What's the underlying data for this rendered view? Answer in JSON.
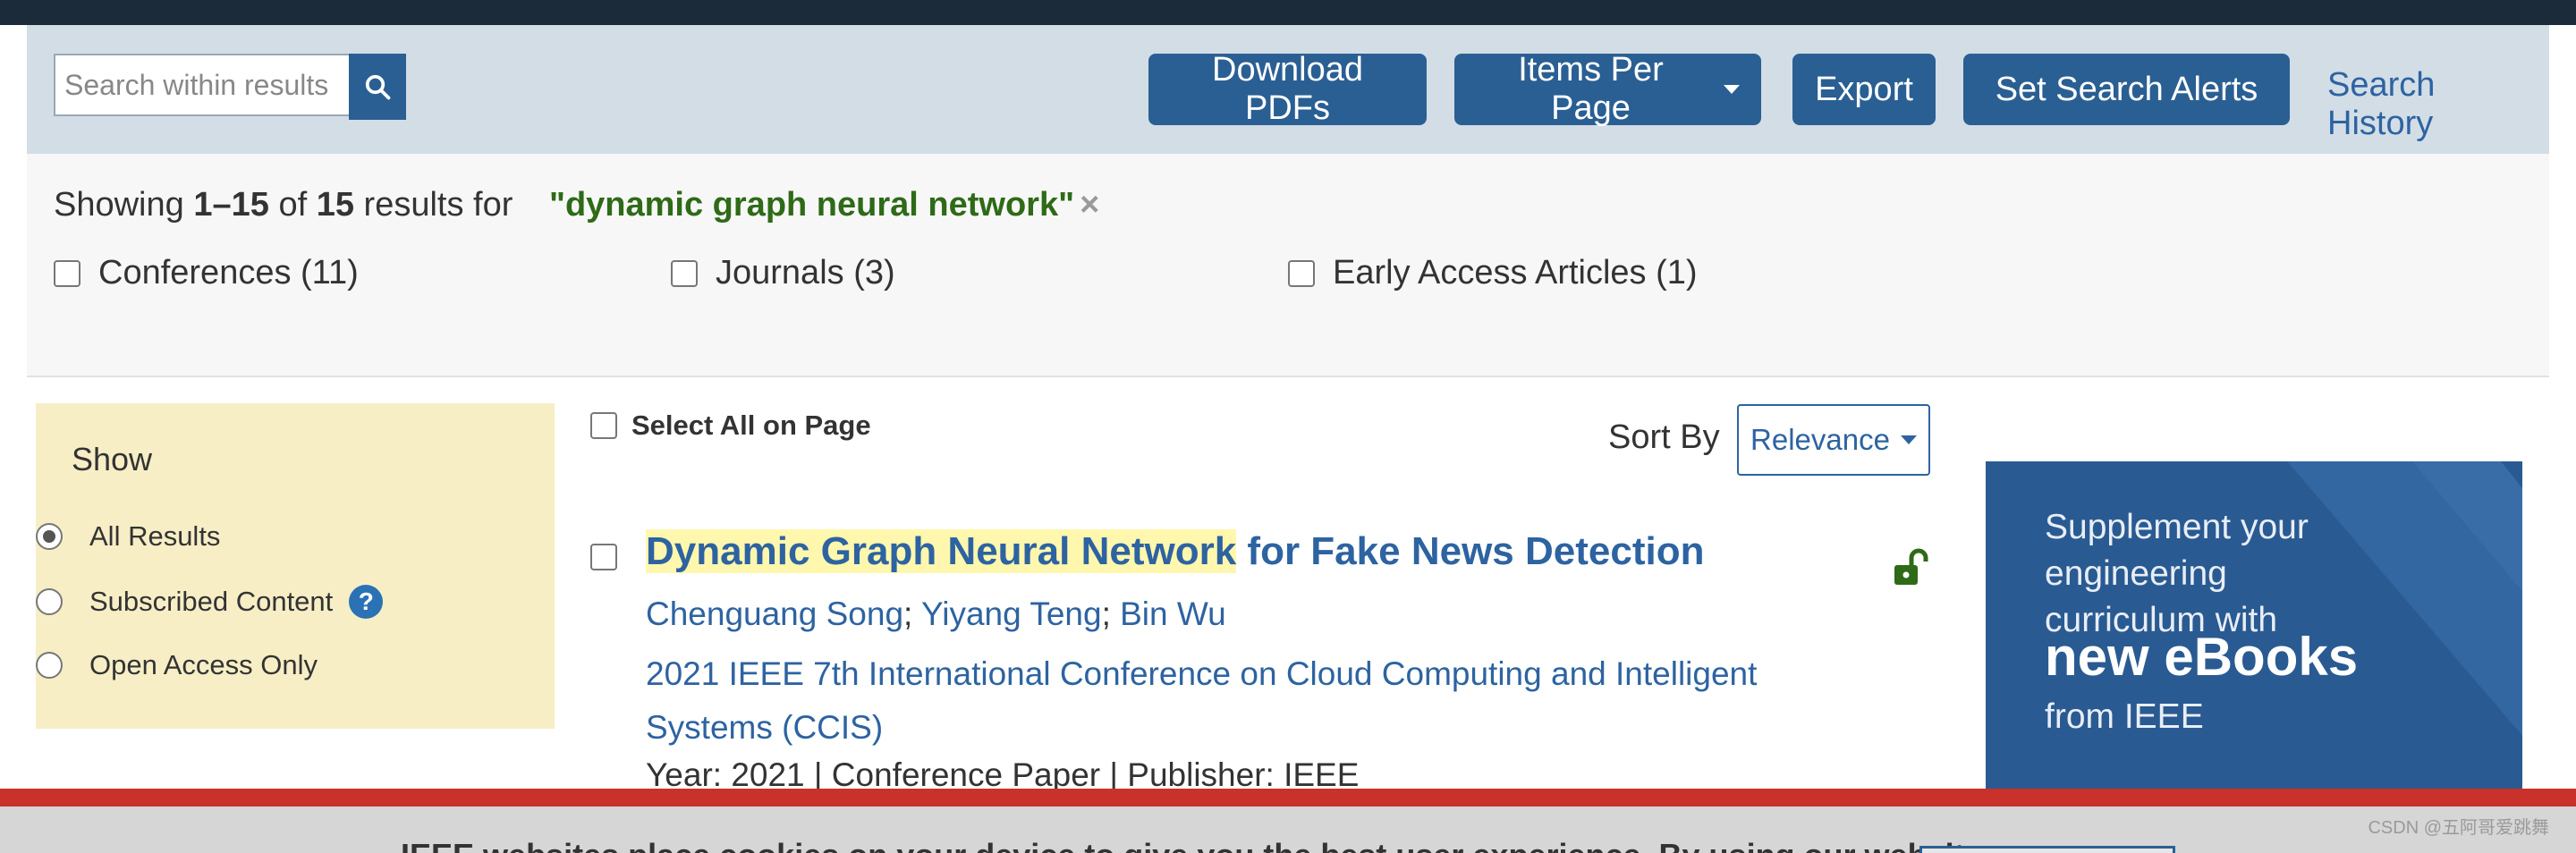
{
  "toolbar": {
    "search_placeholder": "Search within results",
    "download_pdfs": "Download PDFs",
    "items_per_page": "Items Per Page",
    "export": "Export",
    "set_search_alerts": "Set Search Alerts",
    "search_history": "Search History"
  },
  "results_summary": {
    "showing": "Showing",
    "range": "1–15",
    "of": "of",
    "total": "15",
    "results_for": "results for",
    "query": "\"dynamic graph neural network\"",
    "clear_symbol": "×"
  },
  "facets": [
    {
      "label": "Conferences (11)"
    },
    {
      "label": "Journals (3)"
    },
    {
      "label": "Early Access Articles (1)"
    }
  ],
  "filters": {
    "title": "Show",
    "options": [
      {
        "label": "All Results",
        "selected": true
      },
      {
        "label": "Subscribed Content",
        "selected": false
      },
      {
        "label": "Open Access Only",
        "selected": false
      }
    ],
    "help_symbol": "?"
  },
  "list_controls": {
    "select_all": "Select All on Page",
    "sort_by": "Sort By",
    "sort_value": "Relevance"
  },
  "results": [
    {
      "title_highlight": "Dynamic Graph Neural Network",
      "title_rest": " for Fake News Detection",
      "authors": [
        "Chenguang Song",
        "Yiyang Teng",
        "Bin Wu"
      ],
      "author_sep": ";",
      "publication": "2021 IEEE 7th International Conference on Cloud Computing and Intelligent Systems (CCIS)",
      "meta": "Year: 2021 | Conference Paper | Publisher: IEEE",
      "open_access_icon": "unlock-icon"
    }
  ],
  "ad": {
    "line1": "Supplement your",
    "line2": "engineering",
    "line3": "curriculum with",
    "bold": "new eBooks",
    "line4": "from IEEE"
  },
  "cookie": {
    "text": "IEEE websites place cookies on your device to give you the best user experience. By using our websites,"
  },
  "watermark": "CSDN @五阿哥爱跳舞",
  "colors": {
    "navy": "#1b2b3a",
    "button": "#2a5f93",
    "link": "#2d63a1",
    "query_green": "#2e6a17",
    "highlight": "#fff7ad",
    "filter_bg": "#f7eec6",
    "cookie_red": "#c8322a"
  }
}
